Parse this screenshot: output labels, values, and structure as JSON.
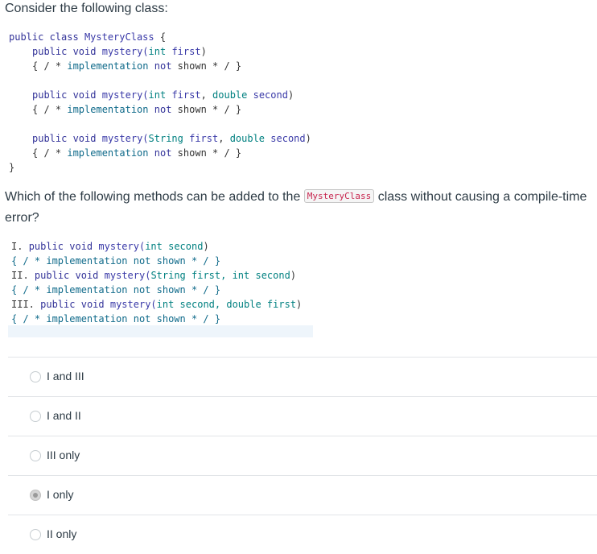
{
  "prompt": "Consider the following class:",
  "class_code": {
    "line1": {
      "kw": "public class",
      "name": "MysteryClass",
      "rest": " {"
    },
    "methods": [
      {
        "sig_kw": "public void",
        "sig_name": "mystery(",
        "params": [
          {
            "type": "int",
            "name": "first"
          }
        ],
        "close": ")"
      },
      {
        "sig_kw": "public void",
        "sig_name": "mystery(",
        "params": [
          {
            "type": "int",
            "name": "first"
          },
          {
            "type": "double",
            "name": "second"
          }
        ],
        "close": ")"
      },
      {
        "sig_kw": "public void",
        "sig_name": "mystery(",
        "params": [
          {
            "type": "String",
            "name": "first"
          },
          {
            "type": "double",
            "name": "second"
          }
        ],
        "close": ")"
      }
    ],
    "body_line": {
      "open": "{ / * ",
      "word1": "implementation",
      "word2": "not",
      "word3": "shown",
      "close": " * / }"
    },
    "closing": "}"
  },
  "question": {
    "before": "Which of the following methods can be added to the ",
    "code_ref": "MysteryClass",
    "after": " class without causing a compile-time error?"
  },
  "candidates": [
    {
      "num": "I.",
      "kw": "public void",
      "name": "mystery(",
      "params": "int second",
      "close": ")"
    },
    {
      "num": "II.",
      "kw": "public void",
      "name": "mystery(",
      "params": "String first, int second",
      "close": ")"
    },
    {
      "num": "III.",
      "kw": "public void",
      "name": "mystery(",
      "params": "int second, double first",
      "close": ")"
    }
  ],
  "candidate_body": "{ / * implementation not shown * / }",
  "options": [
    {
      "label": "I and III",
      "selected": false
    },
    {
      "label": "I and II",
      "selected": false
    },
    {
      "label": "III only",
      "selected": false
    },
    {
      "label": "I only",
      "selected": true
    },
    {
      "label": "II only",
      "selected": false
    }
  ]
}
